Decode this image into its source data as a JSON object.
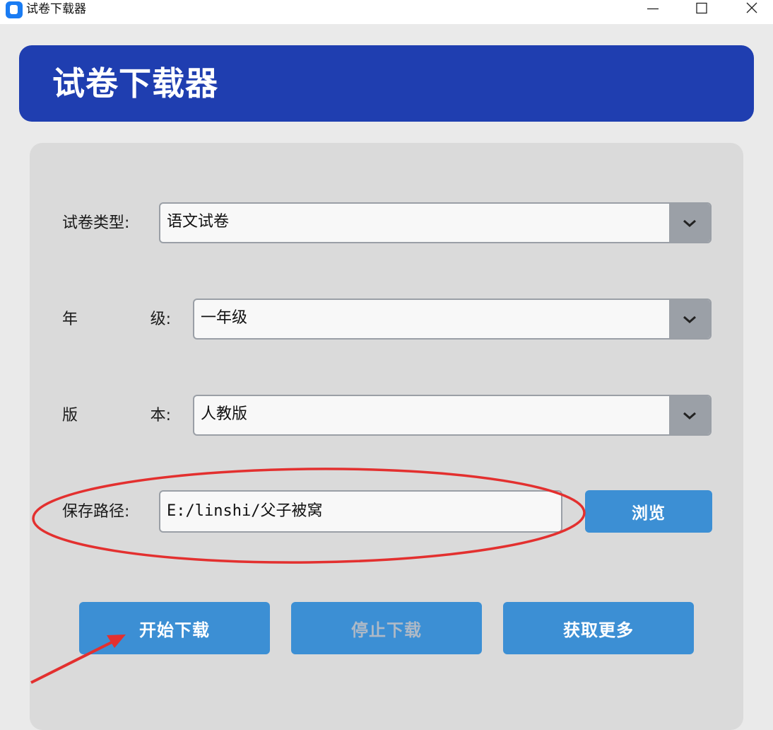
{
  "window": {
    "title": "试卷下载器",
    "icons": [
      "app-icon",
      "minimize-icon",
      "maximize-icon",
      "close-icon"
    ]
  },
  "header": {
    "title": "试卷下载器",
    "background": "#1f3eb0"
  },
  "form": {
    "paper_type": {
      "label": "试卷类型:",
      "value": "语文试卷"
    },
    "grade": {
      "label_left": "年",
      "label_right": "级:",
      "value": "一年级"
    },
    "edition": {
      "label_left": "版",
      "label_right": "本:",
      "value": "人教版"
    },
    "save_path": {
      "label": "保存路径:",
      "value": "E:/linshi/父子被窝",
      "browse_label": "浏览"
    }
  },
  "actions": {
    "start_label": "开始下载",
    "stop_label": "停止下载",
    "more_label": "获取更多"
  },
  "colors": {
    "accent": "#3c8fd4",
    "annotation": "#e3302f"
  }
}
